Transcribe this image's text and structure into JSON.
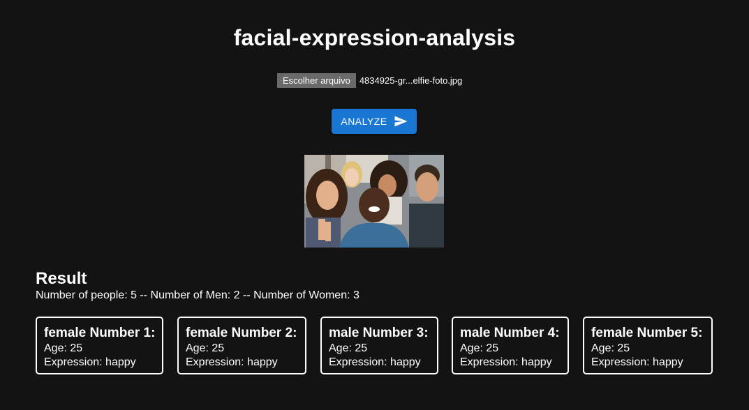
{
  "page": {
    "title": "facial-expression-analysis"
  },
  "upload": {
    "button_label": "Escolher arquivo",
    "file_name": "4834925-gr...elfie-foto.jpg"
  },
  "analyze": {
    "label": "ANALYZE",
    "icon": "send-icon"
  },
  "image": {
    "subject": "group-selfie-photo"
  },
  "result": {
    "heading": "Result",
    "summary": "Number of people: 5 -- Number of Men: 2 -- Number of Women: 3",
    "people": [
      {
        "title": "female Number 1:",
        "age": "Age: 25",
        "expression": "Expression: happy"
      },
      {
        "title": "female Number 2:",
        "age": "Age: 25",
        "expression": "Expression: happy"
      },
      {
        "title": "male Number 3:",
        "age": "Age: 25",
        "expression": "Expression: happy"
      },
      {
        "title": "male Number 4:",
        "age": "Age: 25",
        "expression": "Expression: happy"
      },
      {
        "title": "female Number 5:",
        "age": "Age: 25",
        "expression": "Expression: happy"
      }
    ]
  },
  "colors": {
    "background": "#131313",
    "accent": "#1976d2",
    "file_button": "#6a6a6a",
    "text": "#ffffff"
  }
}
